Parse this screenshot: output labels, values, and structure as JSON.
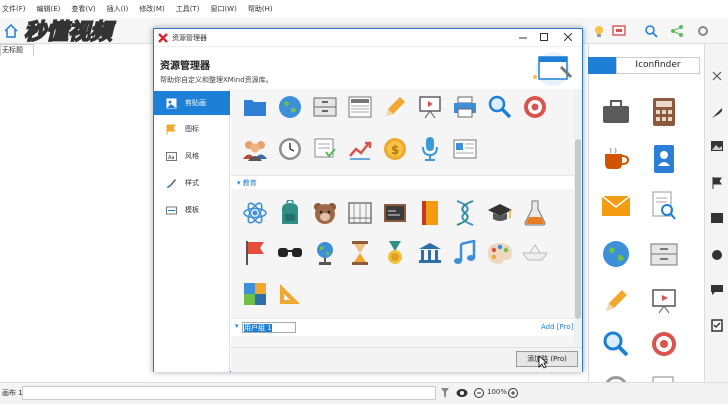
{
  "menubar": {
    "items": [
      "文件(F)",
      "编辑(E)",
      "查看(V)",
      "插入(I)",
      "修改(M)",
      "工具(T)",
      "窗口(W)",
      "帮助(H)"
    ]
  },
  "watermark": {
    "text": "秒懂视频"
  },
  "document": {
    "tab_label": "无标题"
  },
  "dialog": {
    "title": "资源管理器",
    "header_title": "资源管理器",
    "header_subtitle": "帮助你自定义和整理XMind资源库。",
    "sidebar": [
      {
        "label": "剪贴画",
        "active": true
      },
      {
        "label": "图标",
        "active": false
      },
      {
        "label": "风格",
        "active": false
      },
      {
        "label": "样式",
        "active": false
      },
      {
        "label": "模板",
        "active": false
      }
    ],
    "sections": [
      {
        "label": "教育"
      }
    ],
    "group": {
      "input_value": "用户组 1",
      "add_link": "Add [Pro]"
    },
    "add_button": "添加路 (Pro)"
  },
  "right_panel": {
    "tab_active": "",
    "tab_iconfinder": "Iconfinder"
  },
  "statusbar": {
    "left_text": "画布 1",
    "zoom": "100%"
  },
  "colors": {
    "accent": "#1e7fd6",
    "dialog_border": "#2b78d6"
  }
}
